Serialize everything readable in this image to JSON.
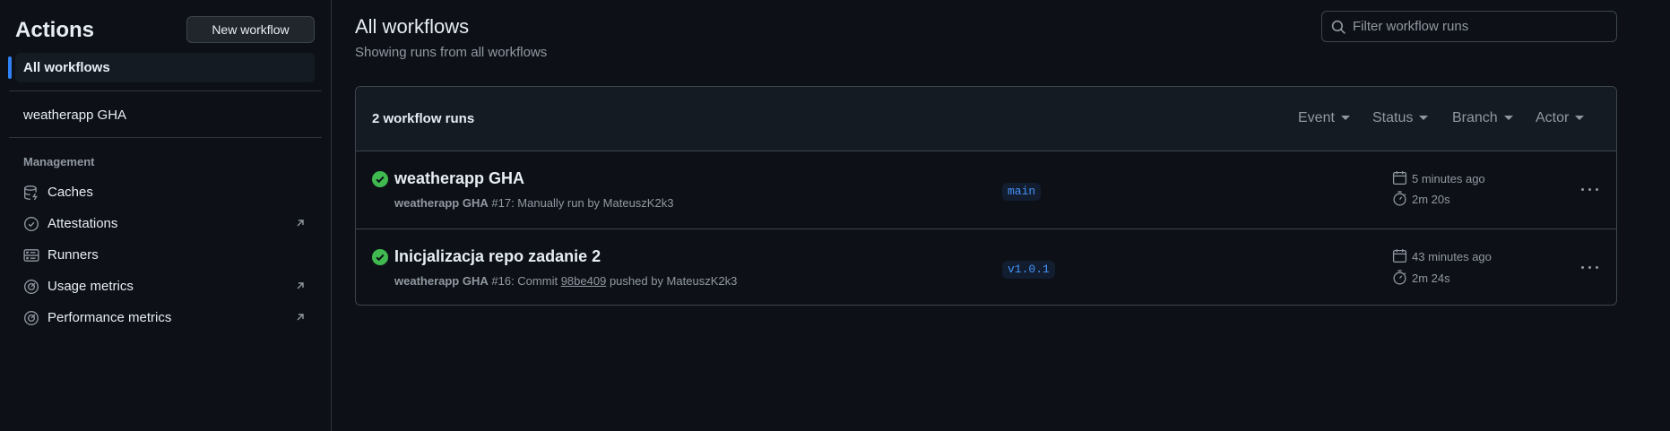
{
  "sidebar": {
    "title": "Actions",
    "new_workflow": "New workflow",
    "all_workflows": "All workflows",
    "workflows": [
      "weatherapp GHA"
    ],
    "section": "Management",
    "items": [
      {
        "label": "Caches",
        "icon": "database-icon",
        "external": false
      },
      {
        "label": "Attestations",
        "icon": "verified-icon",
        "external": true
      },
      {
        "label": "Runners",
        "icon": "server-icon",
        "external": false
      },
      {
        "label": "Usage metrics",
        "icon": "meter-icon",
        "external": true
      },
      {
        "label": "Performance metrics",
        "icon": "meter-icon",
        "external": true
      }
    ]
  },
  "header": {
    "title": "All workflows",
    "subtitle": "Showing runs from all workflows",
    "filter_placeholder": "Filter workflow runs"
  },
  "runs": {
    "count_label": "2 workflow runs",
    "filters": [
      "Event",
      "Status",
      "Branch",
      "Actor"
    ],
    "rows": [
      {
        "title": "weatherapp GHA",
        "workflow": "weatherapp GHA",
        "detail": "#17: Manually run by MateuszK2k3",
        "branch": "main",
        "when": "5 minutes ago",
        "duration": "2m 20s",
        "status": "success"
      },
      {
        "title": "Inicjalizacja repo zadanie 2",
        "workflow": "weatherapp GHA",
        "detail_prefix": "#16: Commit",
        "sha": "98be409",
        "detail_suffix": "pushed by MateuszK2k3",
        "branch": "v1.0.1",
        "when": "43 minutes ago",
        "duration": "2m 24s",
        "status": "success"
      }
    ]
  },
  "colors": {
    "accent": "#2f81f7",
    "success": "#3fb950",
    "link": "#4493f8",
    "bg": "#0d1117"
  }
}
